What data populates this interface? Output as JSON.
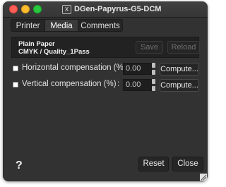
{
  "window": {
    "title": "DGen-Papyrus-G5-DCM",
    "title_icon": "x11-icon",
    "title_icon_glyph": "X"
  },
  "tabs": [
    {
      "label": "Printer",
      "active": false
    },
    {
      "label": "Media",
      "active": true
    },
    {
      "label": "Comments",
      "active": false
    }
  ],
  "preset": {
    "line1": "Plain Paper",
    "line2": "CMYK / Quality_1Pass",
    "save_label": "Save",
    "reload_label": "Reload"
  },
  "settings": [
    {
      "label": "Horizontal compensation (%)",
      "colon": ":",
      "value": "0.00",
      "checked": false,
      "button": "Compute..."
    },
    {
      "label": "Vertical compensation (%)",
      "colon": ":",
      "value": "0.00",
      "checked": false,
      "button": "Compute..."
    }
  ],
  "footer": {
    "help_label": "?",
    "reset_label": "Reset",
    "close_label": "Close"
  },
  "colors": {
    "window_bg": "#323232",
    "close": "#ff5f57",
    "minimize": "#febc2e",
    "zoom": "#28c840"
  }
}
